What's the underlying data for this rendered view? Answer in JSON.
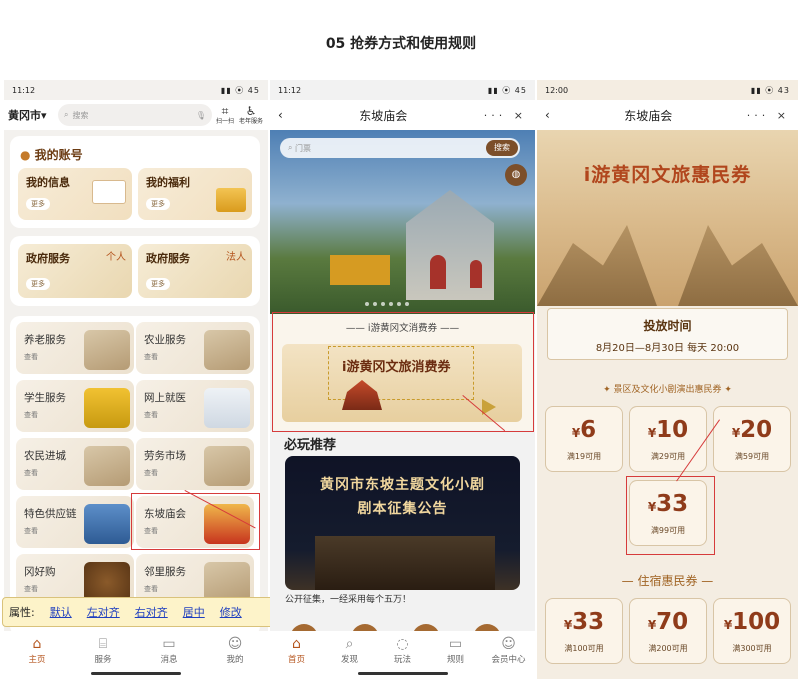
{
  "page_title": "05  抢券方式和使用规则",
  "phone1": {
    "status_time": "11:12",
    "status_icons": "▮▮ ⦿ 45",
    "city": "黄冈市▾",
    "search_placeholder": "搜索",
    "scan_label": "扫一扫",
    "elder_label": "老年服务",
    "account_title": "我的账号",
    "tiles": [
      {
        "title": "我的信息",
        "more": "更多"
      },
      {
        "title": "我的福利",
        "more": "更多"
      }
    ],
    "gov": [
      {
        "title": "政府服务",
        "tag": "个人",
        "more": "更多"
      },
      {
        "title": "政府服务",
        "tag": "法人",
        "more": "更多"
      }
    ],
    "services": [
      {
        "title": "养老服务",
        "more": "查看"
      },
      {
        "title": "农业服务",
        "more": "查看"
      },
      {
        "title": "学生服务",
        "more": "查看"
      },
      {
        "title": "网上就医",
        "more": "查看"
      },
      {
        "title": "农民进城",
        "more": "查看"
      },
      {
        "title": "劳务市场",
        "more": "查看"
      },
      {
        "title": "特色供应链",
        "more": "查看"
      },
      {
        "title": "东坡庙会",
        "more": "查看"
      },
      {
        "title": "冈好购",
        "more": "查看"
      },
      {
        "title": "邻里服务",
        "more": "查看"
      }
    ],
    "attr_label": "属性:",
    "attr_links": [
      "默认",
      "左对齐",
      "右对齐",
      "居中",
      "修改"
    ],
    "tabs": [
      {
        "label": "主页",
        "icon": "⌂"
      },
      {
        "label": "服务",
        "icon": "⌸"
      },
      {
        "label": "消息",
        "icon": "▭"
      },
      {
        "label": "我的",
        "icon": "☺"
      }
    ]
  },
  "phone2": {
    "status_time": "11:12",
    "status_icons": "▮▮ ⦿ 45",
    "title": "东坡庙会",
    "nav_actions": "··· ×",
    "search_placeholder": "门票",
    "search_button": "搜索",
    "coupon_header": "—— i游黄冈文消费券 ——",
    "coupon_title": "i游黄冈文旅消费券",
    "rec_header": "必玩推荐",
    "rec_line1": "黄冈市东坡主题文化小剧",
    "rec_line2": "剧本征集公告",
    "rec_caption": "公开征集，一经采用每个五万！",
    "tabs": [
      {
        "label": "首页",
        "icon": "⌂"
      },
      {
        "label": "发现",
        "icon": "⌕"
      },
      {
        "label": "玩法",
        "icon": "◌"
      },
      {
        "label": "规则",
        "icon": "▭"
      },
      {
        "label": "会员中心",
        "icon": "☺"
      }
    ]
  },
  "phone3": {
    "status_time": "12:00",
    "status_icons": "▮▮ ⦿ 43",
    "title": "东坡庙会",
    "nav_actions": "··· ×",
    "hero_title": "i游黄冈文旅惠民券",
    "release_label": "投放时间",
    "release_time": "8月20日—8月30日 每天 20:00",
    "section1": "✦ 景区及文化小剧演出惠民券 ✦",
    "coupons1": [
      {
        "value": "6",
        "cond": "满19可用"
      },
      {
        "value": "10",
        "cond": "满29可用"
      },
      {
        "value": "20",
        "cond": "满59可用"
      },
      {
        "value": "33",
        "cond": "满99可用"
      }
    ],
    "section2": "— 住宿惠民券 —",
    "coupons2": [
      {
        "value": "33",
        "cond": "满100可用"
      },
      {
        "value": "70",
        "cond": "满200可用"
      },
      {
        "value": "100",
        "cond": "满300可用"
      }
    ],
    "currency": "¥"
  },
  "colors": {
    "highlight": "#d63b3b",
    "brand_brown": "#b5561f"
  }
}
